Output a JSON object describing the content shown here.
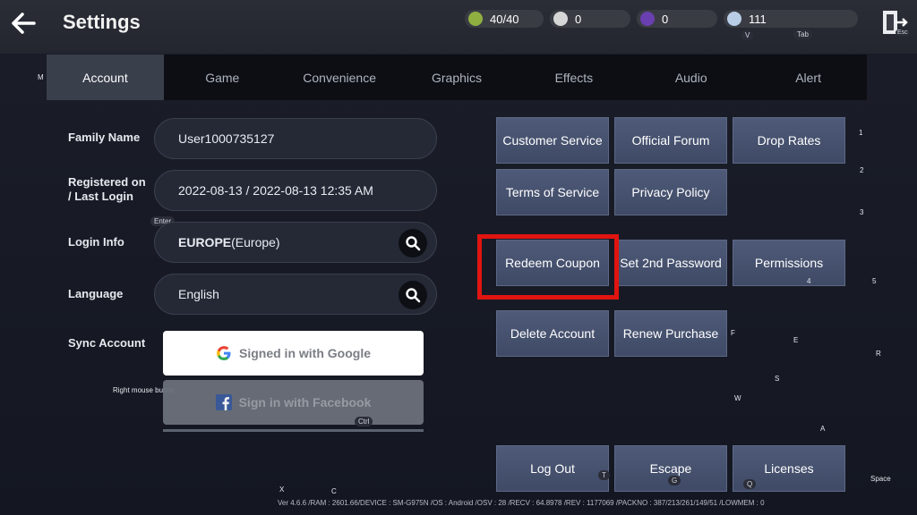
{
  "header": {
    "title": "Settings",
    "exit_hint": "Esc",
    "currencies": [
      {
        "name": "stamina",
        "value": "40/40",
        "color": "#8fb040"
      },
      {
        "name": "silver",
        "value": "0",
        "color": "#d6d6d6"
      },
      {
        "name": "pearl",
        "value": "0",
        "color": "#6a3fb0"
      },
      {
        "name": "crystal",
        "value": "111",
        "color": "#b9cde6"
      }
    ],
    "hint_v": "V",
    "hint_tab": "Tab"
  },
  "tabs": [
    "Account",
    "Game",
    "Convenience",
    "Graphics",
    "Effects",
    "Audio",
    "Alert"
  ],
  "tab_hint": "M",
  "account": {
    "family_name_label": "Family Name",
    "family_name_value": "User1000735127",
    "registered_label_1": "Registered on",
    "registered_label_2": "/ Last Login",
    "registered_value": "2022-08-13 / 2022-08-13  12:35  AM",
    "enter_hint": "Enter",
    "login_info_label": "Login Info",
    "login_region_bold": "EUROPE",
    "login_region_rest": "(Europe)",
    "language_label": "Language",
    "language_value": "English",
    "sync_label": "Sync Account",
    "google_label": "Signed in with Google",
    "facebook_label": "Sign in with Facebook",
    "right_mouse_hint": "Right mouse button",
    "ctrl_hint": "Ctrl"
  },
  "buttons": {
    "customer_service": "Customer Service",
    "official_forum": "Official Forum",
    "drop_rates": "Drop Rates",
    "terms": "Terms of Service",
    "privacy": "Privacy Policy",
    "redeem": "Redeem Coupon",
    "set_password": "Set 2nd Password",
    "permissions": "Permissions",
    "delete_account": "Delete Account",
    "renew_purchase": "Renew Purchase",
    "log_out": "Log Out",
    "escape": "Escape",
    "licenses": "Licenses"
  },
  "key_hints": {
    "k1": "1",
    "k2": "2",
    "k3": "3",
    "k4": "4",
    "k5": "5",
    "f": "F",
    "e": "E",
    "r": "R",
    "s": "S",
    "w": "W",
    "a": "A",
    "t": "T",
    "g": "G",
    "q": "Q",
    "space": "Space",
    "x": "X",
    "c": "C"
  },
  "version": "Ver 4.6.6 /RAM : 2601.66/DEVICE : SM-G975N /OS : Android /OSV : 28 /RECV : 64.8978 /REV : 1177069 /PACKNO : 387/213/261/149/51 /LOWMEM : 0",
  "colors": {
    "highlight": "#e01410",
    "button": "#4a5572",
    "tab_active": "#3a3f4c"
  }
}
